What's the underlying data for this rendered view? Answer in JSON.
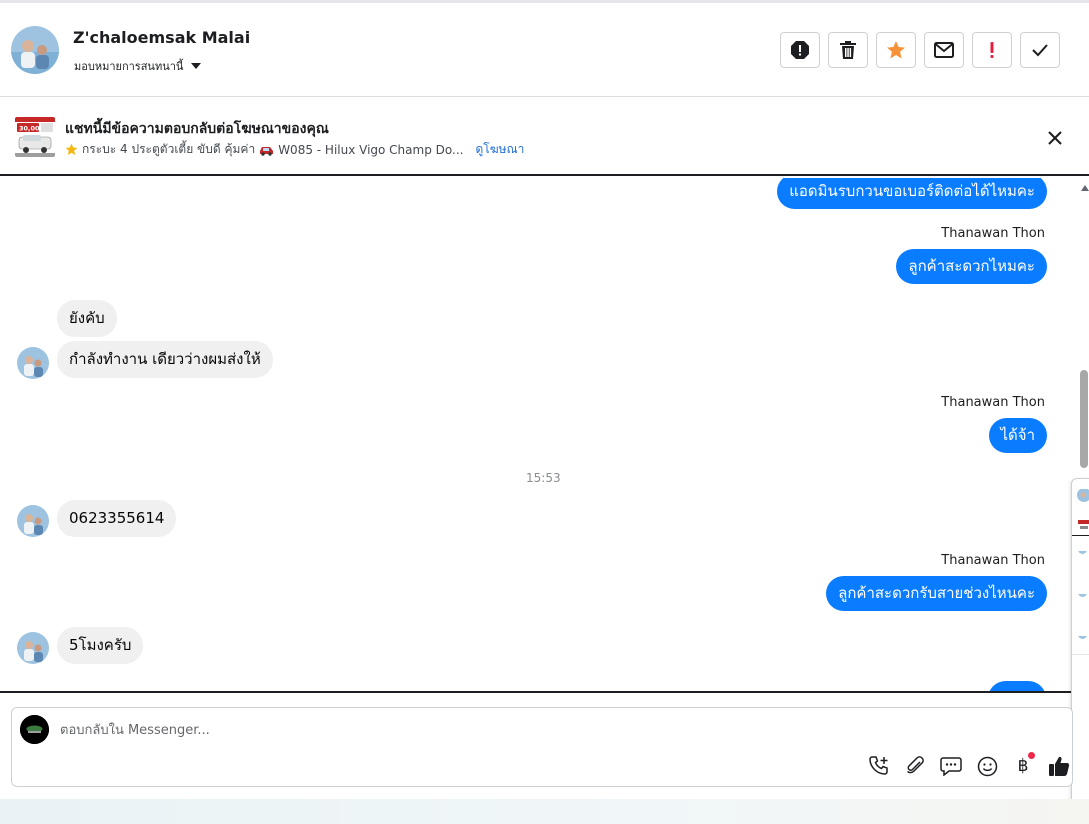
{
  "header": {
    "contact_name": "Z'chaloemsak Malai",
    "assign_label": "มอบหมายการสนทนานี้",
    "actions": [
      "report-icon",
      "trash-icon",
      "star-icon",
      "envelope-icon",
      "exclamation-icon",
      "check-icon"
    ],
    "star_color": "#f7923a",
    "exclamation_color": "#e41e3f"
  },
  "ad_banner": {
    "title": "แชทนี้มีข้อความตอบกลับต่อโฆษณาของคุณ",
    "ad_text": "กระบะ 4 ประตูตัวเตี้ย ขับดี คุ้มค่า",
    "ad_model": "W085 - Hilux Vigo Champ Do...",
    "view_ad": "ดูโฆษณา",
    "thumb_price": "30,000"
  },
  "thread": {
    "messages": [
      {
        "dir": "out",
        "text": "แอดมินรบกวนขอเบอร์ติดต่อได้ไหมคะ"
      },
      {
        "dir": "out",
        "sender": "Thanawan Thon",
        "text": "ลูกค้าสะดวกไหมคะ"
      },
      {
        "dir": "in",
        "text": "ยังคับ"
      },
      {
        "dir": "in",
        "text": "กำลังทำงาน เดียวว่างผมส่งให้"
      },
      {
        "dir": "out",
        "sender": "Thanawan Thon",
        "text": "ได้จ้า"
      },
      {
        "dir": "in",
        "text": "0623355614"
      },
      {
        "dir": "out",
        "sender": "Thanawan Thon",
        "text": "ลูกค้าสะดวกรับสายช่วงไหนคะ"
      },
      {
        "dir": "in",
        "text": "5โมงครับ"
      }
    ],
    "timestamp": "15:53",
    "accent": "#0a7cff"
  },
  "composer": {
    "placeholder": "ตอบกลับใน Messenger...",
    "tools": [
      "call-add-icon",
      "paperclip-icon",
      "saved-reply-icon",
      "emoji-icon",
      "baht-icon",
      "thumbs-up-icon"
    ],
    "baht_symbol": "฿"
  }
}
